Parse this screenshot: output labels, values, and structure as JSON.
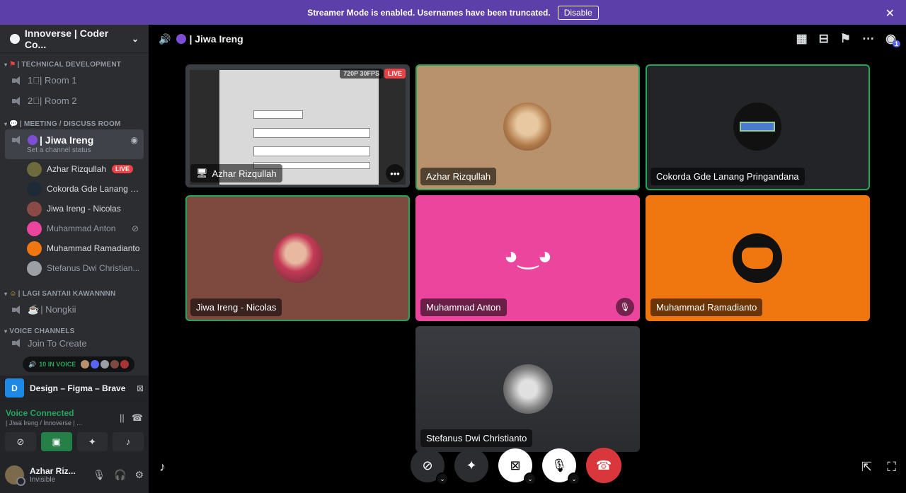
{
  "banner": {
    "text": "Streamer Mode is enabled. Usernames have been truncated.",
    "button": "Disable"
  },
  "server": {
    "name": "Innoverse | Coder Co..."
  },
  "categories": {
    "tech": "| TECHNICAL DEVELOPMENT",
    "meeting": "| MEETING / DISCUSS ROOM",
    "santai": "| LAGI SANTAII KAWANNNN",
    "voice": "VOICE CHANNELS"
  },
  "channels": {
    "room1": "1⃣| Room 1",
    "room2": "2⃣| Room 2",
    "jiwa": "| Jiwa Ireng",
    "jiwa_status": "Set a channel status",
    "nongkii": "| Nongkii",
    "join": "Join To Create"
  },
  "members": [
    {
      "name": "Azhar Rizqullah",
      "badge": "LIVE",
      "color": "#6d6a3d"
    },
    {
      "name": "Cokorda Gde Lanang P...",
      "color": "#1f2a38"
    },
    {
      "name": "Jiwa Ireng - Nicolas",
      "color": "#8a4a45"
    },
    {
      "name": "Muhammad Anton",
      "color": "#eb459e"
    },
    {
      "name": "Muhammad Ramadianto",
      "color": "#f0760f"
    },
    {
      "name": "Stefanus Dwi Christian...",
      "color": "#9aa0a6"
    }
  ],
  "in_voice": {
    "label": "10 IN VOICE"
  },
  "activity": {
    "icon_letter": "D",
    "title": "Design – Figma – Brave"
  },
  "voice": {
    "status": "Voice Connected",
    "channel": "| Jiwa Ireng / Innoverse | ..."
  },
  "user": {
    "name": "Azhar Riz...",
    "status": "Invisible"
  },
  "topbar": {
    "title": "| Jiwa Ireng",
    "notification_count": "1"
  },
  "tiles": {
    "stream": {
      "name": "Azhar Rizqullah",
      "quality": "720P 30FPS",
      "live": "LIVE"
    },
    "azhar": {
      "name": "Azhar Rizqullah",
      "bg": "#b7926c"
    },
    "cokorda": {
      "name": "Cokorda Gde Lanang Pringandana",
      "bg": "#232428"
    },
    "jiwa": {
      "name": "Jiwa Ireng - Nicolas",
      "bg": "#7e4a40"
    },
    "anton": {
      "name": "Muhammad Anton",
      "bg": "#eb459e"
    },
    "ramadianto": {
      "name": "Muhammad Ramadianto",
      "bg": "#f0760f"
    },
    "stefanus": {
      "name": "Stefanus Dwi Christianto",
      "bg": "#313338"
    }
  },
  "colors": {
    "speaking": "#23a55a",
    "live": "#ed4245",
    "banner": "#5c3fa8"
  }
}
